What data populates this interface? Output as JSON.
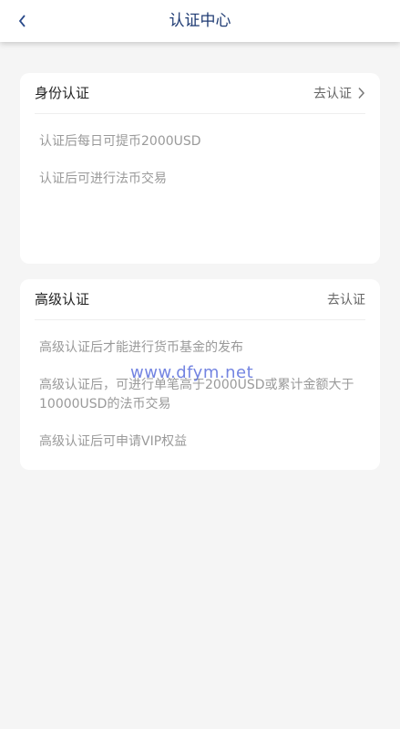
{
  "header": {
    "title": "认证中心"
  },
  "cards": [
    {
      "title": "身份认证",
      "action": "去认证",
      "items": [
        "认证后每日可提币2000USD",
        "认证后可进行法币交易"
      ]
    },
    {
      "title": "高级认证",
      "action": "去认证",
      "items": [
        "高级认证后才能进行货币基金的发布",
        "高级认证后，可进行单笔高于2000USD或累计金额大于10000USD的法币交易",
        "高级认证后可申请VIP权益"
      ]
    }
  ],
  "watermark": "www.dfym.net",
  "colors": {
    "title": "#1f3b73",
    "background": "#f5f5f5",
    "card": "#ffffff",
    "muted_text": "#9a9a9a"
  }
}
